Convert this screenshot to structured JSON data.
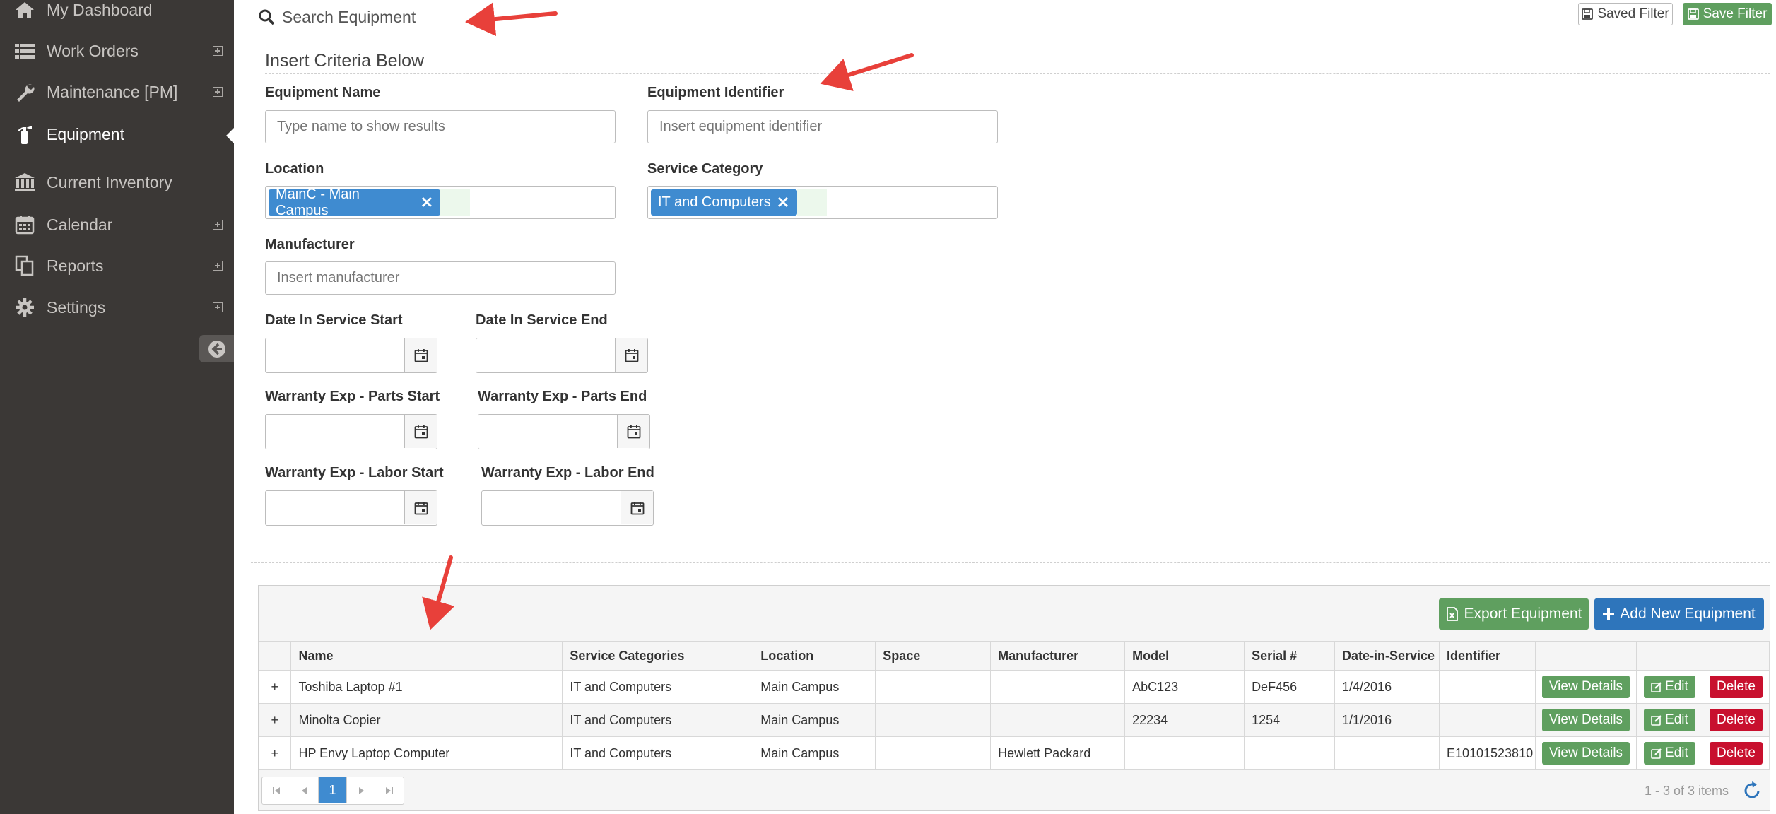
{
  "sidebar": {
    "items": [
      {
        "label": "My Dashboard",
        "icon": "home-icon",
        "expandable": false
      },
      {
        "label": "Work Orders",
        "icon": "list-icon",
        "expandable": true
      },
      {
        "label": "Maintenance [PM]",
        "icon": "wrench-icon",
        "expandable": true
      },
      {
        "label": "Equipment",
        "icon": "fire-extinguisher-icon",
        "expandable": false,
        "active": true
      },
      {
        "label": "Current Inventory",
        "icon": "bank-icon",
        "expandable": false
      },
      {
        "label": "Calendar",
        "icon": "calendar-icon",
        "expandable": true
      },
      {
        "label": "Reports",
        "icon": "copy-icon",
        "expandable": true
      },
      {
        "label": "Settings",
        "icon": "gear-icon",
        "expandable": true
      }
    ]
  },
  "search": {
    "title": "Search Equipment",
    "saved_filter_label": "Saved Filter",
    "save_filter_label": "Save Filter"
  },
  "criteria": {
    "title": "Insert Criteria Below",
    "equipment_name": {
      "label": "Equipment Name",
      "placeholder": "Type name to show results"
    },
    "equipment_identifier": {
      "label": "Equipment Identifier",
      "placeholder": "Insert equipment identifier"
    },
    "location": {
      "label": "Location",
      "tag": "MainC - Main Campus"
    },
    "service_category": {
      "label": "Service Category",
      "tag": "IT and Computers"
    },
    "manufacturer": {
      "label": "Manufacturer",
      "placeholder": "Insert manufacturer"
    },
    "date_in_service_start": "Date In Service Start",
    "date_in_service_end": "Date In Service End",
    "warranty_parts_start": "Warranty Exp - Parts Start",
    "warranty_parts_end": "Warranty Exp - Parts End",
    "warranty_labor_start": "Warranty Exp - Labor Start",
    "warranty_labor_end": "Warranty Exp - Labor End"
  },
  "grid": {
    "export_label": "Export Equipment",
    "add_label": "Add New Equipment",
    "columns": [
      "Name",
      "Service Categories",
      "Location",
      "Space",
      "Manufacturer",
      "Model",
      "Serial #",
      "Date-in-Service",
      "Identifier"
    ],
    "rows": [
      {
        "name": "Toshiba Laptop #1",
        "name_color": "blue",
        "service_categories": "IT and Computers",
        "location": "Main Campus",
        "space": "",
        "manufacturer": "",
        "model": "AbC123",
        "serial": "DeF456",
        "date_in_service": "1/4/2016",
        "identifier": ""
      },
      {
        "name": "Minolta Copier",
        "name_color": "red",
        "service_categories": "IT and Computers",
        "location": "Main Campus",
        "space": "",
        "manufacturer": "",
        "model": "22234",
        "serial": "1254",
        "date_in_service": "1/1/2016",
        "identifier": ""
      },
      {
        "name": "HP Envy Laptop Computer",
        "name_color": "blue",
        "service_categories": "IT and Computers",
        "location": "Main Campus",
        "space": "",
        "manufacturer": "Hewlett Packard",
        "model": "",
        "serial": "",
        "date_in_service": "",
        "identifier": "E10101523810"
      }
    ],
    "row_actions": {
      "view": "View Details",
      "edit": "Edit",
      "delete": "Delete"
    },
    "expand_symbol": "+",
    "pager": {
      "current_page": "1",
      "info": "1 - 3 of 3 items"
    }
  },
  "colors": {
    "sidebar_bg": "#3b3836",
    "primary_blue": "#2e75bb",
    "tag_blue": "#3f8bd0",
    "success_green": "#5f9f5f",
    "danger_red": "#c8102e",
    "annotation_red": "#e8403a"
  }
}
